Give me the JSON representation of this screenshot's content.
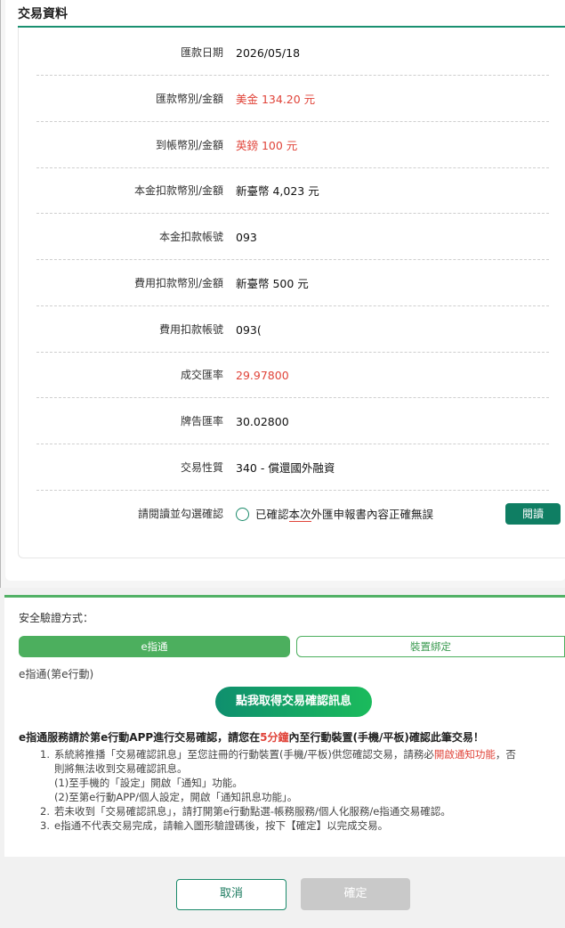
{
  "section_title": "交易資料",
  "rows": [
    {
      "label": "匯款日期",
      "value": "2026/05/18"
    },
    {
      "label": "匯款幣別/金額",
      "value": "美金 134.20 元"
    },
    {
      "label": "到帳幣別/金額",
      "value": "英鎊 100 元"
    },
    {
      "label": "本金扣款幣別/金額",
      "value": "新臺幣 4,023 元"
    },
    {
      "label": "本金扣款帳號",
      "value": "093"
    },
    {
      "label": "費用扣款幣別/金額",
      "value": "新臺幣 500 元"
    },
    {
      "label": "費用扣款帳號",
      "value": "093("
    },
    {
      "label": "成交匯率",
      "value": "29.97800"
    },
    {
      "label": "牌告匯率",
      "value": "30.02800"
    },
    {
      "label": "交易性質",
      "value": "340 - 償還國外融資"
    }
  ],
  "confirm": {
    "label": "請閱讀並勾選確認",
    "text_before": "已確認",
    "text_highlight": "本次",
    "text_after": "外匯申報書內容正確無誤",
    "read_button": "閱讀"
  },
  "verify": {
    "label": "安全驗證方式：",
    "tab_active": "e指通",
    "tab_inactive": "裝置綁定",
    "method": "e指通(第e行動)",
    "get_button": "點我取得交易確認訊息"
  },
  "notice": {
    "text_before": "e指通服務請於第e行動APP進行交易確認，請您在",
    "text_em": "5分鐘",
    "text_after": "內至行動裝置(手機/平板)確認此筆交易！"
  },
  "steps": [
    {
      "n": "1.",
      "line1_before": "系統將推播「交易確認訊息」至您註冊的行動裝置(手機/平板)供您確認交易，請務必",
      "line1_em": "開啟通知功能",
      "line1_after": "，否",
      "line2": "則將無法收到交易確認訊息。",
      "line3": "(1)至手機的「設定」開啟「通知」功能。",
      "line4": "(2)至第e行動APP/個人設定，開啟「通知訊息功能」。"
    },
    {
      "n": "2.",
      "text": "若未收到「交易確認訊息」，請打開第e行動點選-帳務服務/個人化服務/e指通交易確認。"
    },
    {
      "n": "3.",
      "text": "e指通不代表交易完成，請輸入圖形驗證碼後，按下【確定】以完成交易。"
    }
  ],
  "footer": {
    "cancel": "取消",
    "ok": "確定"
  },
  "colors": {
    "accent": "#0f7e63",
    "tab_green": "#4caf5e",
    "red": "#e0443a",
    "disabled": "#c9c9c9"
  }
}
